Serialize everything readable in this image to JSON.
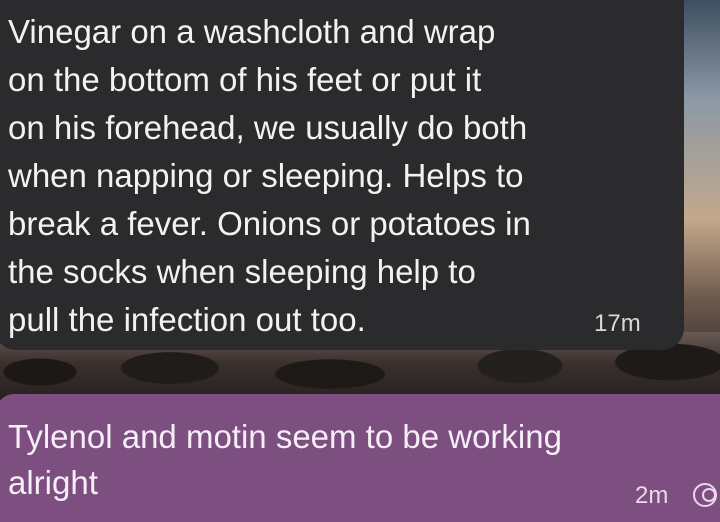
{
  "conversation": {
    "received_message": {
      "text": "Vinegar on a washcloth and wrap\non the bottom of his feet or put it\non his forehead, we usually do both\nwhen napping or sleeping. Helps to\nbreak a fever. Onions or potatoes in\nthe socks when sleeping help to\npull the infection out too.",
      "time": "17m"
    },
    "sent_message": {
      "text": "Tylenol and motin seem to be working\nalright",
      "time": "2m",
      "status_icon": "read-receipt-icon"
    }
  },
  "colors": {
    "received_bubble": "#2b2b2d",
    "sent_bubble": "#7d4f80"
  }
}
